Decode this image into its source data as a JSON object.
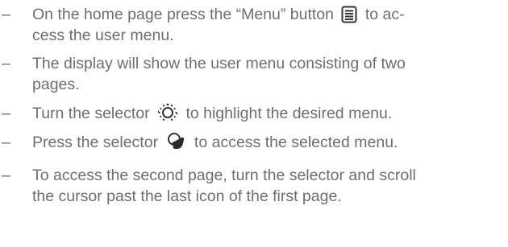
{
  "dash": "–",
  "items": [
    {
      "lines": [
        [
          "On the home page press the “Menu” button ",
          "menu-icon",
          " to ac-"
        ],
        [
          "cess the user menu."
        ]
      ]
    },
    {
      "lines": [
        [
          "The display will show the user menu consisting of two"
        ],
        [
          "pages."
        ]
      ]
    },
    {
      "lines": [
        [
          "Turn the selector ",
          "rotate-selector-icon",
          " to highlight the desired menu."
        ]
      ]
    },
    {
      "lines": [
        [
          "Press the selector ",
          "press-selector-icon",
          " to access the selected menu."
        ]
      ]
    },
    {
      "lines": [
        [
          "To access the second page, turn the selector and scroll"
        ],
        [
          "the cursor past the last icon of the first page."
        ]
      ]
    }
  ],
  "item_1_line_1": "On the home page press the “Menu” button",
  "item_1_line_1_end": "to ac-",
  "item_1_line_2": "cess the user menu.",
  "item_2_line_1": "The display will show the user menu consisting of two",
  "item_2_line_2": "pages.",
  "item_3_pre": "Turn the selector",
  "item_3_post": "to highlight the desired menu.",
  "item_4_pre": "Press the selector",
  "item_4_post": "to access the selected menu.",
  "item_5_line_1": "To access the second page, turn the selector and scroll",
  "item_5_line_2": "the cursor past the last icon of the first page.",
  "icons": [
    "menu-icon",
    "rotate-selector-icon",
    "press-selector-icon"
  ],
  "text_color": "#6e6e6e",
  "icon_color": "#333333"
}
